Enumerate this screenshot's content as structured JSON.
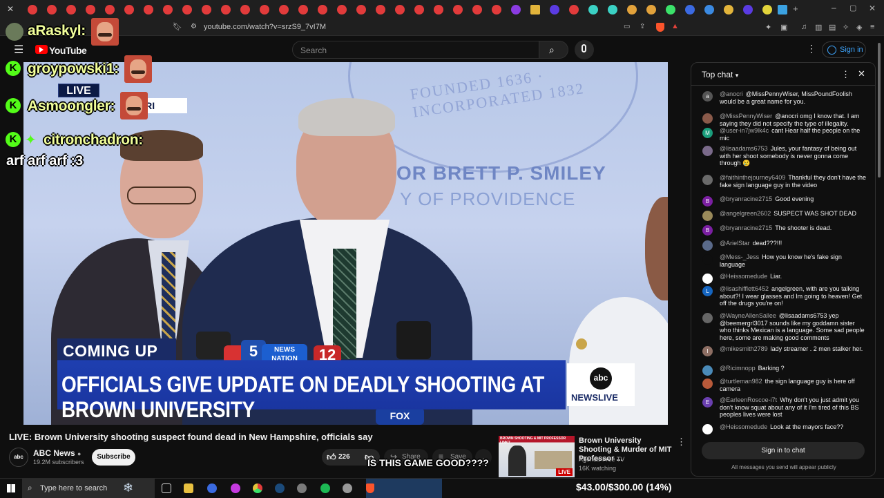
{
  "browser": {
    "url": "youtube.com/watch?v=srzS9_7vI7M"
  },
  "youtube": {
    "logo": "YouTube",
    "search_placeholder": "Search",
    "sign_in": "Sign in"
  },
  "overlay_chat": {
    "entries": [
      {
        "name": "aRaskyl:",
        "message": ""
      },
      {
        "name": "groypowski1:",
        "message": ""
      },
      {
        "name": "Asmoongler:",
        "message": ""
      },
      {
        "name": "citronchadron:",
        "message": "arf arf arf :3"
      }
    ]
  },
  "video": {
    "live_badge": "LIVE",
    "location_badge": "E, RI",
    "wall_line1": "OR BRETT P. SMILEY",
    "wall_line2": "Y OF PROVIDENCE",
    "seal_text": "FOUNDED 1636 · INCORPORATED 1832",
    "coming_up": "COMING UP",
    "banner": "OFFICIALS GIVE UPDATE ON DEADLY SHOOTING AT BROWN UNIVERSITY",
    "abc_logo": "abc",
    "abc_live": "NEWSLIVE",
    "mic_labels": [
      "5",
      "NEWS NATION",
      "12",
      "FOX"
    ]
  },
  "below_video": {
    "title": "LIVE: Brown University shooting suspect found dead in New Hampshire, officials say",
    "channel_name": "ABC News",
    "channel_avatar": "abc",
    "subscribers": "19.2M subscribers",
    "subscribe": "Subscribe",
    "likes": "226",
    "share": "Share",
    "save": "Save",
    "game_question": "IS THIS GAME GOOD????"
  },
  "related": {
    "thumb_title": "BROWN SHOOTING & MIT PROFESSOR LINK?",
    "live_badge": "LIVE",
    "title": "Brown University Shooting & Murder of MIT Professor ...",
    "channel": "Agenda-Free TV",
    "watching": "16K watching"
  },
  "chat": {
    "header": "Top chat",
    "messages": [
      {
        "author": "@anocri",
        "text": "@MissPennyWiser, MissPoundFoolish would be a great name for you.",
        "avatar": "a",
        "color": "#555555"
      },
      {
        "author": "@MissPennyWiser",
        "text": "@anocri omg I know that. I am saying they did not specify the type of illegality.",
        "avatar": "",
        "color": "#8a5a4a"
      },
      {
        "author": "@user-in7jw9lk4c",
        "text": "cant Hear half the people on the mic",
        "avatar": "M",
        "color": "#1a9e7c"
      },
      {
        "author": "@lisaadams6753",
        "text": "Jules, your fantasy of being out with her shoot somebody is never gonna come through 😢",
        "avatar": "",
        "color": "#7a6a8a"
      },
      {
        "author": "@faithinthejourney6409",
        "text": "Thankful they don't have the fake sign language guy in the video",
        "avatar": "",
        "color": "#6a6a6a"
      },
      {
        "author": "@bryanracine2715",
        "text": "Good evening",
        "avatar": "B",
        "color": "#7b1fa2"
      },
      {
        "author": "@angelgreen2602",
        "text": "SUSPECT WAS SHOT DEAD",
        "avatar": "",
        "color": "#9a8a5a"
      },
      {
        "author": "@bryanracine2715",
        "text": "The shooter is dead.",
        "avatar": "B",
        "color": "#7b1fa2"
      },
      {
        "author": "@ArielStar",
        "text": "dead???!!!",
        "avatar": "",
        "color": "#5a6a8a"
      },
      {
        "author": "@Mess-_Jess",
        "text": "How you know he's fake sign language",
        "avatar": "",
        "color": "#0f0f0f"
      },
      {
        "author": "@Heissomedude",
        "text": "Liar.",
        "avatar": "",
        "color": "#ffffff"
      },
      {
        "author": "@lisashifflett6452",
        "text": "angelgreen, with are you talking about?! I wear glasses and Im going to heaven! Get off the drugs you're on!",
        "avatar": "L",
        "color": "#1565c0"
      },
      {
        "author": "@WayneAllenSallee",
        "text": "@lisaadams6753 yep @beemergrl3017 sounds like my goddamn sister who thinks Mexican is a language. Some sad people here, some are making good comments",
        "avatar": "",
        "color": "#666666"
      },
      {
        "author": "@mikesmith2789",
        "text": "lady streamer . 2 men stalker her.",
        "avatar": "I",
        "color": "#8d6e63"
      },
      {
        "author": "@Ricimnopp",
        "text": "Barking ?",
        "avatar": "",
        "color": "#4a8ab8"
      },
      {
        "author": "@turtleman982",
        "text": "the sign language guy is here off camera",
        "avatar": "",
        "color": "#b85a3a"
      },
      {
        "author": "@EarleenRoscoe-i7t",
        "text": "Why don't you just admit you don't know squat about any of it I'm tired of this BS peoples lives were lost",
        "avatar": "E",
        "color": "#6a3fb0"
      },
      {
        "author": "@Heissomedude",
        "text": "Look at the mayors face??",
        "avatar": "",
        "color": "#ffffff"
      }
    ],
    "sign_in": "Sign in to chat",
    "note": "All messages you send will appear publicly"
  },
  "taskbar": {
    "search": "Type here to search",
    "donation": "$43.00/$300.00 (14%)"
  }
}
